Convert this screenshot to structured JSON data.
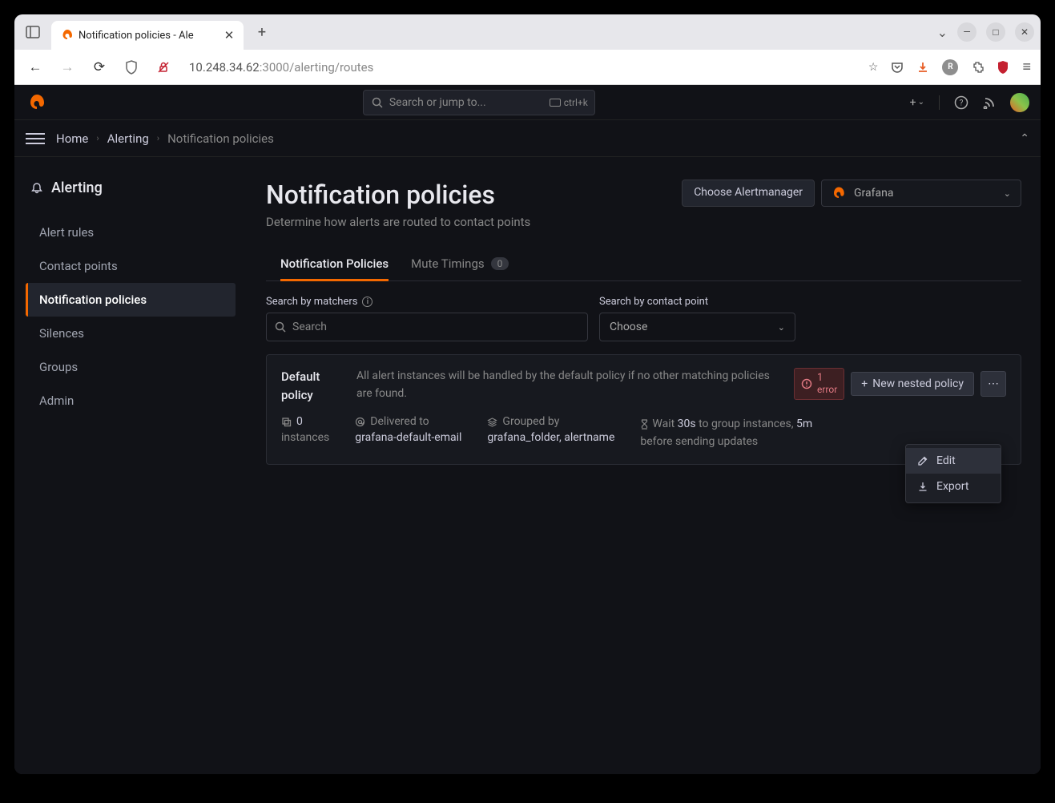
{
  "browser": {
    "tab_title": "Notification policies - Ale",
    "url_host": "10.248.34.62",
    "url_port": ":3000",
    "url_path": "/alerting/routes"
  },
  "header": {
    "search_placeholder": "Search or jump to...",
    "search_kbd": "ctrl+k"
  },
  "breadcrumb": {
    "home": "Home",
    "section": "Alerting",
    "current": "Notification policies"
  },
  "sidebar": {
    "heading": "Alerting",
    "items": [
      {
        "label": "Alert rules"
      },
      {
        "label": "Contact points"
      },
      {
        "label": "Notification policies"
      },
      {
        "label": "Silences"
      },
      {
        "label": "Groups"
      },
      {
        "label": "Admin"
      }
    ]
  },
  "page": {
    "title": "Notification policies",
    "desc": "Determine how alerts are routed to contact points",
    "am_button": "Choose Alertmanager",
    "am_selected": "Grafana"
  },
  "tabs": {
    "policies": "Notification Policies",
    "mute": "Mute Timings",
    "mute_count": "0"
  },
  "filters": {
    "matchers_label": "Search by matchers",
    "matchers_placeholder": "Search",
    "contact_label": "Search by contact point",
    "contact_placeholder": "Choose"
  },
  "policy": {
    "name": "Default policy",
    "desc": "All alert instances will be handled by the default policy if no other matching policies are found.",
    "error_count": "1",
    "error_word": "error",
    "new_btn": "New nested policy",
    "instances_count": "0",
    "instances_label": "instances",
    "delivered_label": "Delivered to",
    "delivered_value": "grafana-default-email",
    "grouped_label": "Grouped by",
    "grouped_value": "grafana_folder, alertname",
    "wait_prefix": "Wait ",
    "wait_value": "30s",
    "wait_suffix": " to group instances, ",
    "update_value": "5m",
    "update_suffix": " before sending updates"
  },
  "menu": {
    "edit": "Edit",
    "export": "Export"
  }
}
